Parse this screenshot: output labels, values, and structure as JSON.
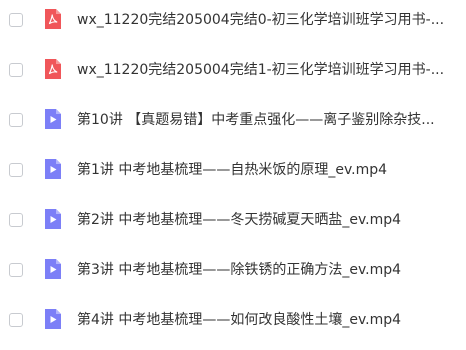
{
  "file_list": {
    "items": [
      {
        "name": "wx_11220完结205004完结0-初三化学培训班学习用书-...",
        "type": "pdf",
        "icon": "pdf-file-icon"
      },
      {
        "name": "wx_11220完结205004完结1-初三化学培训班学习用书-...",
        "type": "pdf",
        "icon": "pdf-file-icon"
      },
      {
        "name": "第10讲 【真题易错】中考重点强化——离子鉴别除杂技...",
        "type": "video",
        "icon": "video-file-icon"
      },
      {
        "name": "第1讲 中考地基梳理——自热米饭的原理_ev.mp4",
        "type": "video",
        "icon": "video-file-icon"
      },
      {
        "name": "第2讲 中考地基梳理——冬天捞碱夏天晒盐_ev.mp4",
        "type": "video",
        "icon": "video-file-icon"
      },
      {
        "name": "第3讲 中考地基梳理——除铁锈的正确方法_ev.mp4",
        "type": "video",
        "icon": "video-file-icon"
      },
      {
        "name": "第4讲 中考地基梳理——如何改良酸性土壤_ev.mp4",
        "type": "video",
        "icon": "video-file-icon"
      }
    ]
  },
  "colors": {
    "pdf_icon": "#f0565a",
    "video_icon": "#7c7ff7",
    "text": "#333333",
    "checkbox_border": "#c8cbd0"
  }
}
